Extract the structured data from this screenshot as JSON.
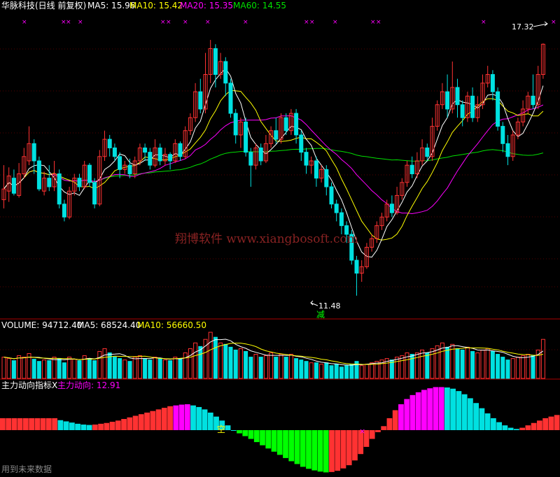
{
  "header": {
    "title": "华脉科技(日线 前复权)",
    "ma5": "MA5: 15.96",
    "ma10": "MA10: 15.42",
    "ma20": "MA20: 15.35",
    "ma60": "MA60: 14.55"
  },
  "volume_header": {
    "label": "VOLUME: 94712.40",
    "ma5": "MA5: 68524.40",
    "ma10": "MA10: 56660.50"
  },
  "indicator_header": {
    "name": "主力动向指标X",
    "series_value": "主力动向: 12.91"
  },
  "annotations": {
    "high": "17.32",
    "low": "11.48",
    "reduce_tag": "减",
    "short_tag": "空",
    "watermark": "翔博软件 www.xiangbosoft.com",
    "footer": "用到未来数据"
  },
  "colors": {
    "up": "#ff3232",
    "down": "#00e1e1",
    "ma5": "#ffffff",
    "ma10": "#ffff00",
    "ma20": "#ff00ff",
    "ma60": "#00e000",
    "grid": "#aa0000",
    "green_bar": "#00ff00",
    "magenta_bar": "#ff00ff"
  },
  "chart_data": {
    "type": "candlestick",
    "high_price": 17.32,
    "low_price": 11.48,
    "price_range": [
      11.2,
      18.0
    ],
    "candles": [
      [
        13.7,
        13.95,
        14.5,
        13.5
      ],
      [
        13.9,
        14.25,
        14.45,
        13.65
      ],
      [
        14.2,
        13.85,
        14.4,
        13.8
      ],
      [
        13.8,
        14.3,
        14.55,
        13.75
      ],
      [
        14.3,
        14.7,
        14.9,
        14.2
      ],
      [
        14.6,
        15.0,
        15.4,
        14.5
      ],
      [
        15.0,
        14.6,
        15.1,
        14.3
      ],
      [
        14.6,
        13.95,
        14.7,
        13.9
      ],
      [
        13.9,
        14.2,
        14.35,
        13.8
      ],
      [
        14.2,
        14.0,
        14.5,
        13.9
      ],
      [
        14.0,
        14.3,
        14.6,
        13.9
      ],
      [
        14.3,
        13.6,
        14.4,
        13.5
      ],
      [
        13.6,
        13.3,
        13.7,
        13.2
      ],
      [
        13.3,
        13.9,
        14.0,
        13.25
      ],
      [
        13.9,
        14.2,
        14.3,
        13.8
      ],
      [
        14.2,
        14.0,
        14.3,
        13.9
      ],
      [
        14.0,
        14.5,
        14.6,
        13.95
      ],
      [
        14.5,
        14.1,
        14.55,
        14.0
      ],
      [
        14.1,
        13.6,
        14.2,
        13.5
      ],
      [
        13.6,
        14.7,
        14.85,
        13.55
      ],
      [
        14.7,
        15.1,
        15.3,
        14.6
      ],
      [
        15.1,
        14.9,
        15.2,
        14.7
      ],
      [
        14.9,
        14.7,
        15.0,
        14.6
      ],
      [
        14.7,
        14.4,
        14.8,
        14.2
      ],
      [
        14.4,
        14.5,
        14.6,
        14.3
      ],
      [
        14.5,
        14.3,
        14.65,
        14.2
      ],
      [
        14.3,
        14.6,
        14.7,
        14.2
      ],
      [
        14.6,
        14.9,
        15.0,
        14.5
      ],
      [
        14.9,
        14.8,
        15.0,
        14.6
      ],
      [
        14.8,
        14.5,
        14.9,
        14.4
      ],
      [
        14.5,
        14.9,
        15.1,
        14.45
      ],
      [
        14.9,
        14.6,
        15.0,
        14.5
      ],
      [
        14.6,
        14.75,
        14.9,
        14.5
      ],
      [
        14.75,
        14.6,
        14.8,
        14.4
      ],
      [
        14.6,
        15.0,
        15.1,
        14.55
      ],
      [
        15.0,
        14.7,
        15.05,
        14.6
      ],
      [
        14.7,
        15.3,
        15.4,
        14.65
      ],
      [
        15.3,
        15.6,
        15.7,
        15.2
      ],
      [
        15.6,
        16.2,
        16.4,
        15.5
      ],
      [
        16.2,
        15.8,
        16.5,
        15.7
      ],
      [
        15.8,
        16.6,
        17.1,
        15.7
      ],
      [
        16.6,
        17.2,
        17.4,
        16.4
      ],
      [
        17.2,
        16.6,
        17.3,
        16.3
      ],
      [
        16.6,
        16.9,
        17.1,
        16.5
      ],
      [
        16.9,
        16.4,
        17.0,
        16.1
      ],
      [
        16.4,
        15.7,
        16.5,
        15.6
      ],
      [
        15.7,
        15.2,
        15.8,
        15.0
      ],
      [
        15.2,
        15.5,
        15.6,
        14.9
      ],
      [
        15.5,
        14.8,
        15.6,
        14.7
      ],
      [
        14.8,
        14.5,
        14.9,
        14.0
      ],
      [
        14.5,
        14.9,
        15.0,
        14.4
      ],
      [
        14.9,
        14.6,
        15.0,
        14.5
      ],
      [
        14.6,
        15.0,
        15.2,
        14.55
      ],
      [
        15.0,
        15.3,
        15.4,
        14.9
      ],
      [
        15.3,
        15.1,
        15.6,
        15.0
      ],
      [
        15.1,
        15.6,
        15.7,
        15.0
      ],
      [
        15.6,
        15.3,
        15.7,
        15.2
      ],
      [
        15.3,
        15.7,
        15.8,
        15.2
      ],
      [
        15.7,
        15.2,
        15.8,
        15.0
      ],
      [
        15.2,
        14.8,
        15.3,
        14.6
      ],
      [
        14.8,
        14.5,
        14.9,
        14.3
      ],
      [
        14.5,
        14.6,
        14.7,
        14.3
      ],
      [
        14.6,
        14.2,
        14.7,
        14.0
      ],
      [
        14.2,
        14.4,
        14.5,
        14.1
      ],
      [
        14.4,
        14.0,
        14.5,
        13.8
      ],
      [
        14.0,
        13.6,
        14.1,
        13.5
      ],
      [
        13.6,
        13.4,
        13.7,
        13.2
      ],
      [
        13.4,
        13.1,
        13.5,
        12.9
      ],
      [
        13.1,
        12.9,
        13.2,
        12.7
      ],
      [
        12.9,
        12.3,
        13.0,
        12.2
      ],
      [
        12.3,
        12.0,
        12.4,
        11.48
      ],
      [
        12.0,
        12.15,
        12.3,
        11.8
      ],
      [
        12.15,
        12.6,
        12.7,
        12.1
      ],
      [
        12.6,
        12.8,
        12.9,
        12.5
      ],
      [
        12.8,
        13.1,
        13.2,
        12.7
      ],
      [
        13.1,
        13.3,
        13.4,
        13.0
      ],
      [
        13.3,
        13.6,
        13.7,
        13.2
      ],
      [
        13.6,
        13.4,
        13.8,
        13.3
      ],
      [
        13.4,
        13.8,
        14.0,
        13.35
      ],
      [
        13.8,
        14.1,
        14.2,
        13.7
      ],
      [
        14.1,
        14.5,
        14.6,
        14.0
      ],
      [
        14.5,
        14.3,
        14.7,
        14.2
      ],
      [
        14.3,
        14.6,
        14.8,
        14.2
      ],
      [
        14.6,
        14.9,
        15.1,
        14.5
      ],
      [
        14.9,
        14.7,
        15.0,
        14.6
      ],
      [
        14.7,
        15.4,
        15.6,
        14.6
      ],
      [
        15.4,
        15.9,
        16.0,
        15.3
      ],
      [
        15.9,
        16.2,
        16.4,
        15.8
      ],
      [
        16.2,
        15.8,
        16.6,
        15.6
      ],
      [
        15.8,
        16.3,
        16.9,
        15.7
      ],
      [
        16.3,
        15.9,
        16.5,
        15.6
      ],
      [
        15.9,
        15.6,
        16.0,
        15.4
      ],
      [
        15.6,
        16.1,
        16.2,
        15.5
      ],
      [
        16.1,
        15.6,
        16.3,
        15.5
      ],
      [
        15.6,
        15.9,
        16.1,
        15.5
      ],
      [
        15.9,
        16.4,
        16.6,
        15.8
      ],
      [
        16.4,
        16.6,
        16.8,
        16.3
      ],
      [
        16.6,
        16.2,
        16.7,
        16.0
      ],
      [
        16.2,
        15.4,
        16.3,
        15.3
      ],
      [
        15.4,
        15.0,
        15.5,
        14.8
      ],
      [
        15.0,
        14.7,
        15.2,
        14.5
      ],
      [
        14.7,
        15.2,
        15.3,
        14.6
      ],
      [
        15.2,
        15.5,
        15.6,
        15.1
      ],
      [
        15.5,
        15.8,
        16.0,
        15.4
      ],
      [
        15.8,
        16.1,
        16.2,
        15.7
      ],
      [
        16.1,
        15.9,
        16.6,
        15.8
      ],
      [
        15.9,
        16.6,
        16.8,
        15.8
      ],
      [
        16.6,
        17.3,
        17.32,
        16.5
      ]
    ],
    "volume_scale": 100000,
    "volume": [
      0.3,
      0.28,
      0.25,
      0.32,
      0.3,
      0.35,
      0.27,
      0.24,
      0.26,
      0.25,
      0.3,
      0.28,
      0.22,
      0.3,
      0.27,
      0.25,
      0.32,
      0.28,
      0.25,
      0.38,
      0.42,
      0.36,
      0.3,
      0.28,
      0.26,
      0.24,
      0.3,
      0.32,
      0.28,
      0.26,
      0.3,
      0.28,
      0.26,
      0.25,
      0.3,
      0.28,
      0.36,
      0.42,
      0.5,
      0.45,
      0.55,
      0.65,
      0.58,
      0.5,
      0.48,
      0.44,
      0.4,
      0.42,
      0.38,
      0.3,
      0.34,
      0.3,
      0.32,
      0.36,
      0.3,
      0.34,
      0.3,
      0.34,
      0.28,
      0.26,
      0.24,
      0.22,
      0.22,
      0.2,
      0.22,
      0.18,
      0.2,
      0.16,
      0.18,
      0.2,
      0.24,
      0.18,
      0.2,
      0.22,
      0.24,
      0.26,
      0.28,
      0.26,
      0.3,
      0.32,
      0.36,
      0.34,
      0.36,
      0.4,
      0.36,
      0.42,
      0.46,
      0.5,
      0.44,
      0.48,
      0.42,
      0.4,
      0.44,
      0.38,
      0.36,
      0.4,
      0.42,
      0.38,
      0.34,
      0.3,
      0.26,
      0.28,
      0.3,
      0.32,
      0.34,
      0.32,
      0.4,
      0.55
    ],
    "indicator": [
      3,
      3,
      3,
      3,
      3,
      3,
      3,
      3,
      3,
      3,
      2.5,
      2.2,
      1.9,
      1.6,
      1.4,
      1.3,
      1.4,
      1.6,
      1.8,
      2.1,
      2.4,
      2.8,
      3.2,
      3.6,
      4.0,
      4.4,
      4.8,
      5.2,
      5.6,
      6.0,
      6.2,
      6.4,
      6.5,
      6.2,
      5.8,
      5.2,
      4.4,
      3.4,
      2.4,
      1.2,
      0,
      -0.8,
      -1.5,
      -2.2,
      -3.0,
      -3.8,
      -4.6,
      -5.4,
      -6.2,
      -7.0,
      -7.8,
      -8.5,
      -9.2,
      -9.7,
      -10.1,
      -10.4,
      -10.6,
      -10.5,
      -10.2,
      -9.6,
      -8.8,
      -7.6,
      -6.0,
      -4.2,
      -2.2,
      -0.5,
      1.0,
      3.0,
      5.0,
      6.5,
      7.8,
      8.8,
      9.5,
      10.1,
      10.5,
      10.8,
      10.8,
      10.7,
      10.4,
      9.8,
      9.0,
      8.0,
      6.8,
      5.5,
      4.2,
      3.0,
      2.0,
      1.2,
      0.6,
      0.3,
      0.6,
      1.2,
      1.8,
      2.4,
      3.0,
      3.4,
      3.8
    ]
  }
}
